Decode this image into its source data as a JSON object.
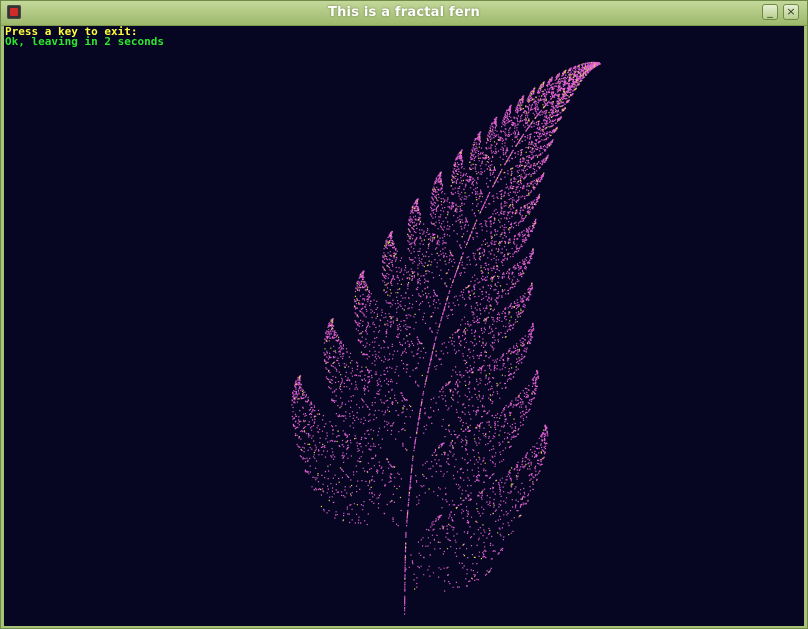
{
  "window": {
    "title": "This is a fractal fern",
    "minimize_glyph": "_",
    "close_glyph": "×"
  },
  "console": {
    "prompt": "Press a key to exit:",
    "status": "Ok, leaving in 2 seconds"
  },
  "colors": {
    "background": "#060522",
    "fern": "#e060d0",
    "speckle": "#d7d84a",
    "prompt_text": "#ffff3c",
    "status_text": "#2fe52f"
  },
  "icons": {
    "app": "app-icon",
    "minimize": "minimize-icon",
    "close": "close-icon"
  }
}
